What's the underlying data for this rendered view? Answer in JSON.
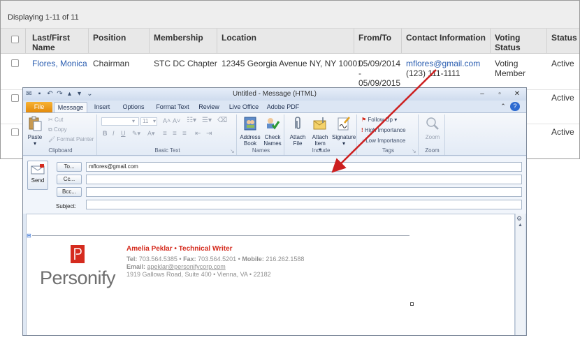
{
  "table": {
    "displaying": "Displaying 1-11 of 11",
    "headers": [
      "Last/First Name",
      "Position",
      "Membership",
      "Location",
      "From/To",
      "Contact Information",
      "Voting Status",
      "Status"
    ],
    "row1": {
      "name": "Flores, Monica",
      "position": "Chairman",
      "membership": "STC DC Chapter",
      "location": "12345 Georgia Avenue NY, NY 10001",
      "from": "05/09/2014",
      "dash": "-",
      "to": "05/09/2015",
      "email": "mflores@gmail.com",
      "phone": "(123) 111-1111",
      "voting": "Voting Member",
      "status": "Active"
    },
    "row2_status": "Active",
    "row3_status": "Active"
  },
  "outlook": {
    "title": "Untitled - Message (HTML)",
    "tabs": [
      "File",
      "Message",
      "Insert",
      "Options",
      "Format Text",
      "Review",
      "Live Office",
      "Adobe PDF"
    ],
    "clipboard": {
      "paste": "Paste",
      "cut": "Cut",
      "copy": "Copy",
      "format_painter": "Format Painter",
      "label": "Clipboard"
    },
    "basic_text": {
      "font_size": "11",
      "label": "Basic Text"
    },
    "names": {
      "address_book": "Address Book",
      "check_names": "Check Names",
      "label": "Names"
    },
    "include": {
      "attach_file": "Attach File",
      "attach_item": "Attach Item",
      "signature": "Signature",
      "label": "Include"
    },
    "tags": {
      "follow_up": "Follow Up",
      "high": "High Importance",
      "low": "Low Importance",
      "label": "Tags"
    },
    "zoom": {
      "zoom": "Zoom",
      "label": "Zoom"
    },
    "compose": {
      "send": "Send",
      "to_btn": "To...",
      "cc_btn": "Cc...",
      "bcc_btn": "Bcc...",
      "subject_label": "Subject:",
      "to_value": "mflores@gmail.com",
      "cc_value": "",
      "bcc_value": "",
      "subject_value": ""
    },
    "signature": {
      "name": "Amelia Peklar • Technical Writer",
      "tel_label": "Tel:",
      "tel": "703.564.5385",
      "fax_label": "Fax:",
      "fax": "703.564.5201",
      "mobile_label": "Mobile:",
      "mobile": "216.262.1588",
      "email_label": "Email:",
      "email": "apeklar@personifycorp.com",
      "address": "1919 Gallows Road, Suite 400 • Vienna, VA • 22182",
      "brand": "Personify"
    }
  },
  "colors": {
    "link": "#2a5db0",
    "brand_red": "#d52b1e",
    "arrow": "#cc1f1f",
    "file_tab": "#e38a0c"
  }
}
